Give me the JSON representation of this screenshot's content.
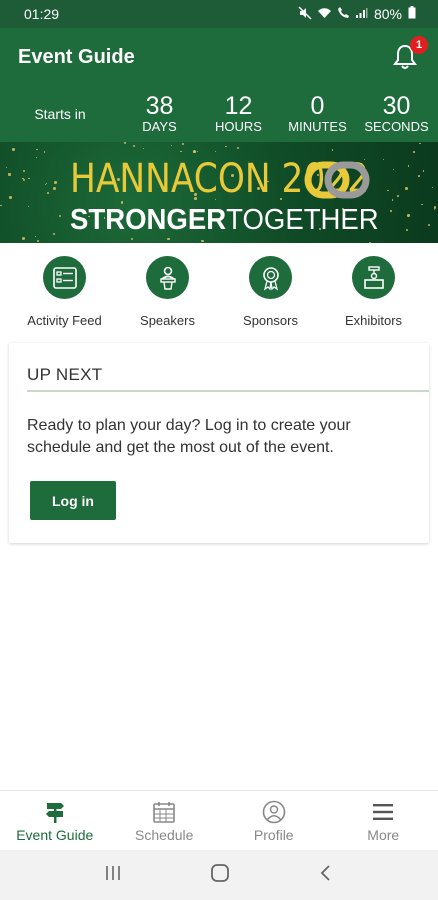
{
  "status_bar": {
    "time": "01:29",
    "battery": "80%"
  },
  "header": {
    "title": "Event Guide",
    "notification_count": "1"
  },
  "countdown": {
    "starts_in_label": "Starts in",
    "units": [
      {
        "value": "38",
        "label": "DAYS"
      },
      {
        "value": "12",
        "label": "HOURS"
      },
      {
        "value": "0",
        "label": "MINUTES"
      },
      {
        "value": "30",
        "label": "SECONDS"
      }
    ]
  },
  "banner": {
    "line1": "HANNACON 2022",
    "line2_bold": "STRONGER",
    "line2_light": "TOGETHER"
  },
  "shortcuts": [
    {
      "label": "Activity Feed",
      "icon": "list-icon"
    },
    {
      "label": "Speakers",
      "icon": "speaker-podium-icon"
    },
    {
      "label": "Sponsors",
      "icon": "award-ribbon-icon"
    },
    {
      "label": "Exhibitors",
      "icon": "exhibitor-booth-icon"
    }
  ],
  "up_next": {
    "title": "UP NEXT",
    "message": "Ready to plan your day? Log in to create your schedule and get the most out of the event.",
    "button": "Log in"
  },
  "bottom_nav": [
    {
      "label": "Event Guide",
      "icon": "signpost-icon",
      "active": true
    },
    {
      "label": "Schedule",
      "icon": "calendar-icon",
      "active": false
    },
    {
      "label": "Profile",
      "icon": "user-circle-icon",
      "active": false
    },
    {
      "label": "More",
      "icon": "hamburger-icon",
      "active": false
    }
  ],
  "colors": {
    "primary": "#1e6b3c",
    "accent_gold": "#e8c93a",
    "badge": "#e02020"
  }
}
